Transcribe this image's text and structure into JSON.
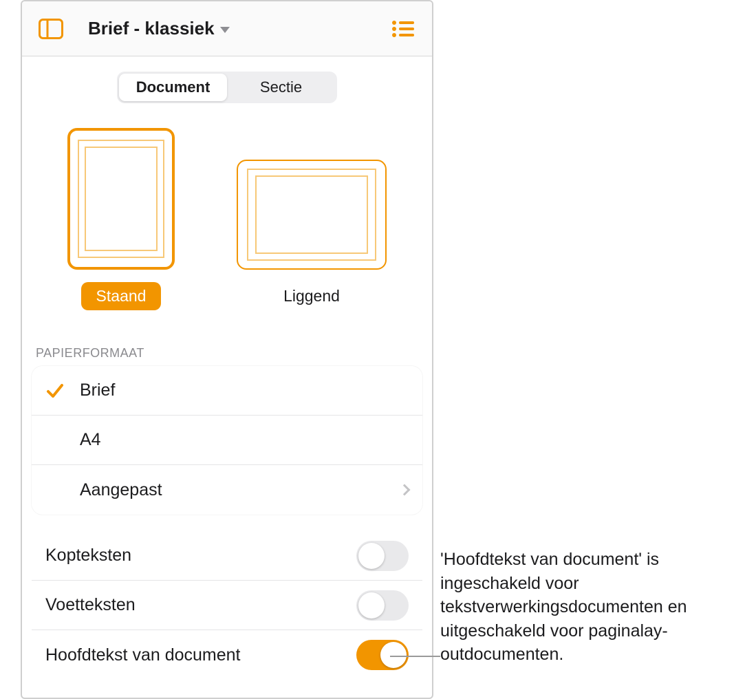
{
  "colors": {
    "accent": "#f29500"
  },
  "toolbar": {
    "title": "Brief - klassiek",
    "sidebar_icon": "sidebar-icon",
    "menu_icon": "list-menu-icon"
  },
  "tabs": {
    "items": [
      {
        "label": "Document",
        "active": true
      },
      {
        "label": "Sectie",
        "active": false
      }
    ]
  },
  "orientation": {
    "portrait_label": "Staand",
    "landscape_label": "Liggend",
    "selected": "portrait"
  },
  "paper_size": {
    "header": "PAPIERFORMAAT",
    "options": [
      {
        "label": "Brief",
        "selected": true,
        "disclosure": false
      },
      {
        "label": "A4",
        "selected": false,
        "disclosure": false
      },
      {
        "label": "Aangepast",
        "selected": false,
        "disclosure": true
      }
    ]
  },
  "toggles": {
    "items": [
      {
        "label": "Kopteksten",
        "on": false
      },
      {
        "label": "Voetteksten",
        "on": false
      },
      {
        "label": "Hoofdtekst van document",
        "on": true
      }
    ]
  },
  "annotation": "'Hoofdtekst van document' is ingeschakeld voor tekstverwerkingsdocumenten en uitgeschakeld voor paginalay-outdocumenten."
}
